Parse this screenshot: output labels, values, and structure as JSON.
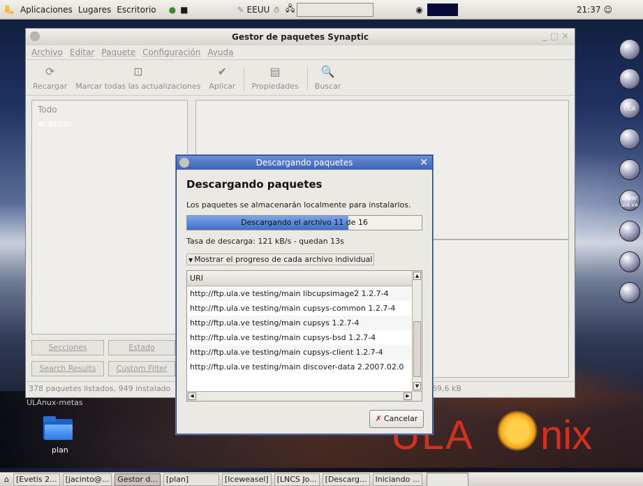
{
  "top_panel": {
    "menus": [
      "Aplicaciones",
      "Lugares",
      "Escritorio"
    ],
    "keyboard": "EEUU",
    "clock": "21:37"
  },
  "synaptic": {
    "title": "Gestor de paquetes Synaptic",
    "menu": [
      "Archivo",
      "Editar",
      "Paquete",
      "Configuración",
      "Ayuda"
    ],
    "toolbar": {
      "reload": "Recargar",
      "mark_all": "Marcar todas las actualizaciones",
      "apply": "Aplicar",
      "properties": "Propiedades",
      "search": "Buscar"
    },
    "filter_header": "Todo",
    "filter_item": "wrapper",
    "buttons": {
      "sections": "Secciones",
      "status": "Estado",
      "search_results": "Search Results",
      "custom_filter": "Custom Filter"
    },
    "status_left": "378 paquetes listados, 949 instalado",
    "status_right": "69,6 kB"
  },
  "dialog": {
    "title": "Descargando paquetes",
    "heading": "Descargando paquetes",
    "info": "Los paquetes se almacenarán localmente para instalarlos.",
    "progress_text": "Descargando el archivo 11 de 16",
    "progress_fraction": 0.6875,
    "rate": "Tasa de descarga: 121 kB/s - quedan 13s",
    "expander": "Mostrar el progreso de cada archivo individual",
    "list_header": "URI",
    "uris": [
      "http://ftp.ula.ve testing/main libcupsimage2 1.2.7-4",
      "http://ftp.ula.ve testing/main cupsys-common 1.2.7-4",
      "http://ftp.ula.ve testing/main cupsys 1.2.7-4",
      "http://ftp.ula.ve testing/main cupsys-bsd 1.2.7-4",
      "http://ftp.ula.ve testing/main cupsys-client 1.2.7-4",
      "http://ftp.ula.ve testing/main discover-data 2.2007.02.0"
    ],
    "cancel": "Cancelar"
  },
  "desktop": {
    "ulanux_label": "ULAnux-metas",
    "folder_label": "plan",
    "dock_labels": [
      "",
      "",
      "CCA",
      "",
      "",
      "saber ula.ve",
      "",
      "",
      ""
    ],
    "logo_left": "ULA",
    "logo_right": "nix"
  },
  "taskbar": {
    "tasks": [
      "[Evetis 2...",
      "[jacinto@...",
      "Gestor d...",
      "[plan]",
      "[Iceweasel]",
      "[LNCS Jo...",
      "[Descarg...",
      "Iniciando ..."
    ]
  }
}
